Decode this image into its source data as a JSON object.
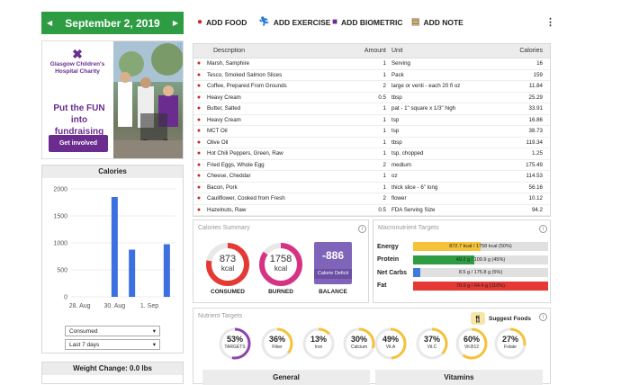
{
  "date_bar": {
    "prev_icon": "◀",
    "date": "September 2, 2019",
    "next_icon": "▶"
  },
  "ad": {
    "logo_lines": "Glasgow Children's Hospital Charity",
    "headline": "Put the FUN into fundraising",
    "button": "Get involved",
    "info_icon": "ⓘ"
  },
  "calories_panel": {
    "title": "Calories",
    "chart_data": {
      "type": "bar",
      "categories": [
        "28. Aug",
        "29. Aug",
        "30. Aug",
        "31. Aug",
        "1. Sep",
        "2. Sep"
      ],
      "x_tick_labels": [
        "28. Aug",
        "30. Aug",
        "1. Sep"
      ],
      "values": [
        0,
        0,
        1850,
        875,
        0,
        975
      ],
      "y_ticks": [
        "2000",
        "1500",
        "1000",
        "500",
        "0"
      ],
      "ylim": [
        0,
        2000
      ],
      "color": "#3c6fe0"
    },
    "metric_select": "Consumed",
    "range_select": "Last 7 days"
  },
  "weight_change": {
    "title": "Weight Change: 0.0 lbs"
  },
  "toolbar": {
    "add_food": "ADD FOOD",
    "add_exercise": "ADD EXERCISE",
    "add_biometric": "ADD BIOMETRIC",
    "add_note": "ADD NOTE",
    "more": "⋮"
  },
  "food_table": {
    "headers": {
      "description": "Description",
      "amount": "Amount",
      "unit": "Unit",
      "calories": "Calories"
    },
    "rows": [
      {
        "desc": "Marsh, Samphire",
        "amt": "1",
        "unit": "Serving",
        "cal": "16"
      },
      {
        "desc": "Tesco, Smoked Salmon Slices",
        "amt": "1",
        "unit": "Pack",
        "cal": "159"
      },
      {
        "desc": "Coffee, Prepared From Grounds",
        "amt": "2",
        "unit": "large or venti - each 20 fl oz",
        "cal": "11.84"
      },
      {
        "desc": "Heavy Cream",
        "amt": "0.5",
        "unit": "tbsp",
        "cal": "25.29"
      },
      {
        "desc": "Butter, Salted",
        "amt": "1",
        "unit": "pat - 1\" square x 1/3\" high",
        "cal": "33.91"
      },
      {
        "desc": "Heavy Cream",
        "amt": "1",
        "unit": "tsp",
        "cal": "16.86"
      },
      {
        "desc": "MCT Oil",
        "amt": "1",
        "unit": "tsp",
        "cal": "38.73"
      },
      {
        "desc": "Olive Oil",
        "amt": "1",
        "unit": "tbsp",
        "cal": "119.34"
      },
      {
        "desc": "Hot Chili Peppers, Green, Raw",
        "amt": "1",
        "unit": "tsp, chopped",
        "cal": "1.25"
      },
      {
        "desc": "Fried Eggs, Whole Egg",
        "amt": "2",
        "unit": "medium",
        "cal": "175.49"
      },
      {
        "desc": "Cheese, Cheddar",
        "amt": "1",
        "unit": "oz",
        "cal": "114.53"
      },
      {
        "desc": "Bacon, Pork",
        "amt": "1",
        "unit": "thick slice - 6\" long",
        "cal": "56.16"
      },
      {
        "desc": "Cauliflower, Cooked from Fresh",
        "amt": "2",
        "unit": "flower",
        "cal": "10.12"
      },
      {
        "desc": "Hazelnuts, Raw",
        "amt": "0.5",
        "unit": "FDA Serving Size",
        "cal": "94.2"
      }
    ]
  },
  "calories_summary": {
    "title": "Calories Summary",
    "consumed": {
      "value": "873",
      "unit": "kcal",
      "label": "CONSUMED"
    },
    "burned": {
      "value": "1758",
      "unit": "kcal",
      "label": "BURNED"
    },
    "balance": {
      "value": "-886",
      "sub": "Calorie Deficit",
      "label": "BALANCE"
    }
  },
  "macro_targets": {
    "title": "Macronutrient Targets",
    "rows": [
      {
        "label": "Energy",
        "text": "872.7 kcal / 1758 kcal (50%)",
        "fill": 0.5,
        "color": "#f5c23a"
      },
      {
        "label": "Protein",
        "text": "49.2 g / 109.9 g (45%)",
        "fill": 0.45,
        "color": "#2e9c43"
      },
      {
        "label": "Net Carbs",
        "text": "8.5 g / 175.8 g (5%)",
        "fill": 0.05,
        "color": "#3c7be0"
      },
      {
        "label": "Fat",
        "text": "70.6 g / 64.4 g (110%)",
        "fill": 1.0,
        "color": "#e53935"
      }
    ]
  },
  "nutrient_targets": {
    "title": "Nutrient Targets",
    "suggest": "Suggest Foods",
    "items": [
      {
        "pct": "53%",
        "name": "TARGETS",
        "value": 0.53,
        "color": "#8e44ad"
      },
      {
        "pct": "36%",
        "name": "Fiber",
        "value": 0.36,
        "color": "#f5c23a"
      },
      {
        "pct": "13%",
        "name": "Iron",
        "value": 0.13,
        "color": "#f5c23a"
      },
      {
        "pct": "30%",
        "name": "Calcium",
        "value": 0.3,
        "color": "#f5c23a"
      },
      {
        "pct": "49%",
        "name": "Vit.A",
        "value": 0.49,
        "color": "#f5c23a"
      },
      {
        "pct": "37%",
        "name": "Vit.C",
        "value": 0.37,
        "color": "#f5c23a"
      },
      {
        "pct": "60%",
        "name": "Vit.B12",
        "value": 0.6,
        "color": "#f5c23a"
      },
      {
        "pct": "27%",
        "name": "Folate",
        "value": 0.27,
        "color": "#f5c23a"
      }
    ],
    "tabs": {
      "general": "General",
      "vitamins": "Vitamins"
    }
  }
}
